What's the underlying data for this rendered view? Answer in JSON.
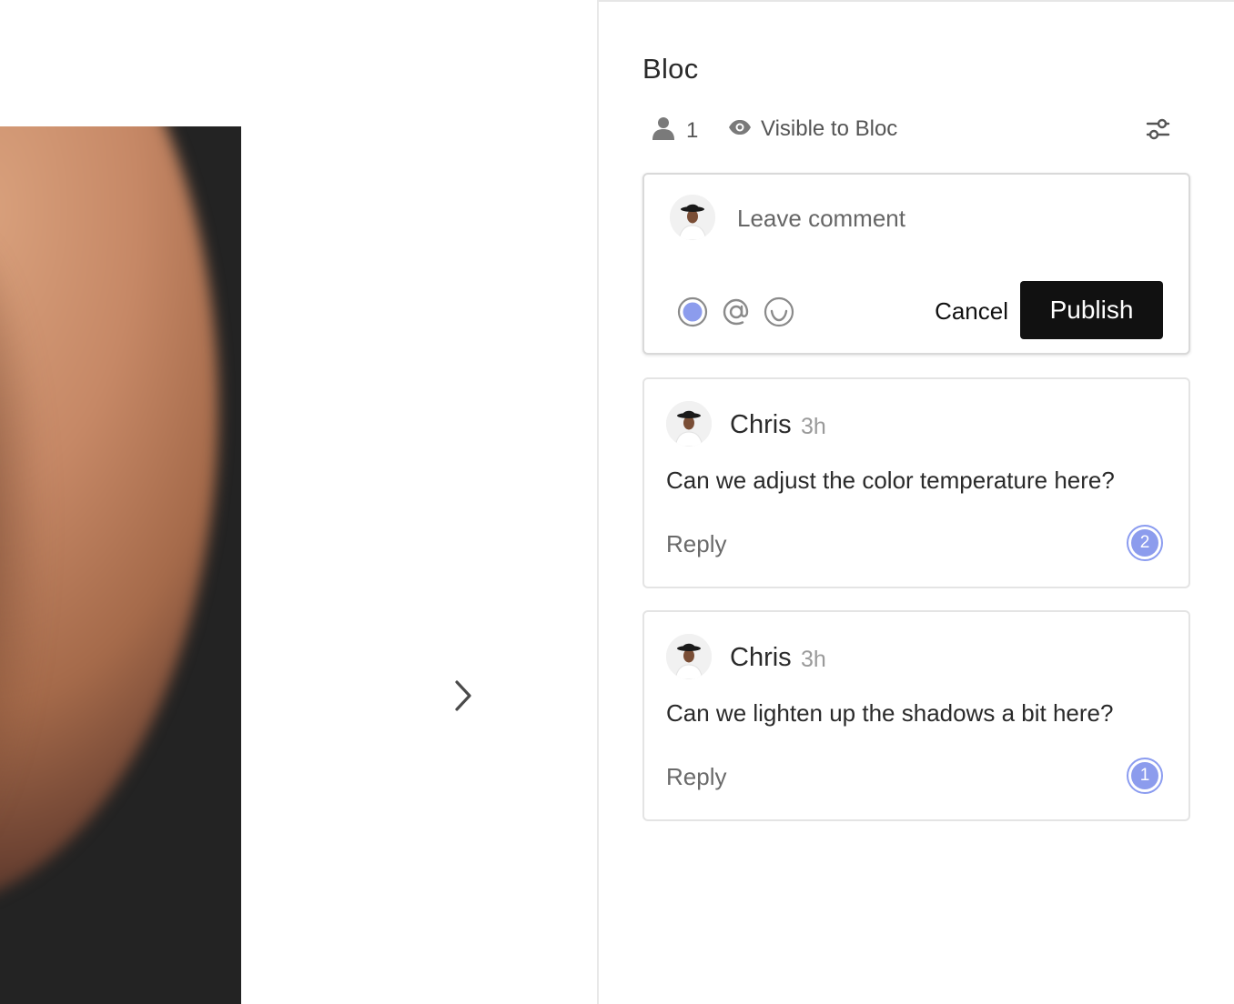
{
  "canvas": {
    "next_icon": "chevron-right-icon"
  },
  "panel": {
    "title": "Bloc",
    "member_count": "1",
    "member_icon": "user-icon",
    "visibility_icon": "eye-icon",
    "visibility_label": "Visible to Bloc",
    "filter_icon": "sliders-icon"
  },
  "composer": {
    "placeholder": "Leave comment",
    "tools": [
      "pin-dot-icon",
      "at-mention-icon",
      "emoji-icon"
    ],
    "cancel_label": "Cancel",
    "publish_label": "Publish",
    "accent_color": "#8c9ced"
  },
  "comments": [
    {
      "author": "Chris",
      "time": "3h",
      "text": "Can we adjust the color temperature here?",
      "reply_label": "Reply",
      "pin_number": "2"
    },
    {
      "author": "Chris",
      "time": "3h",
      "text": "Can we lighten up the shadows a bit here?",
      "reply_label": "Reply",
      "pin_number": "1"
    }
  ]
}
